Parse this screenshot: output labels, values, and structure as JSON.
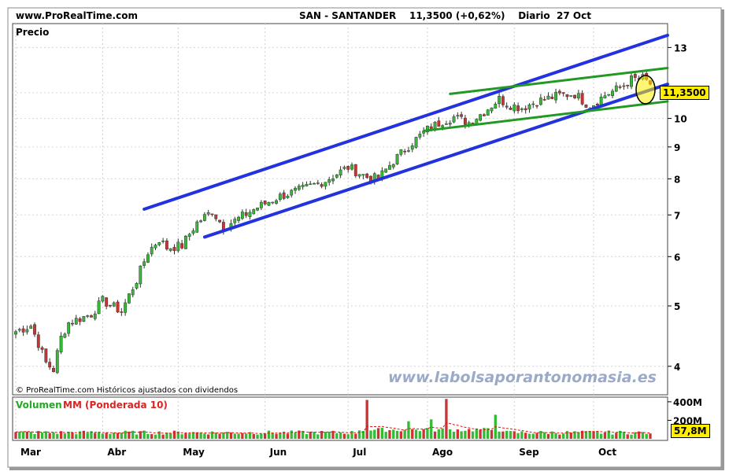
{
  "header": {
    "site": "www.ProRealTime.com",
    "ticker": "SAN - SANTANDER",
    "quote": "11,3500 (+0,62%)",
    "period": "Diario",
    "date": "27 Oct"
  },
  "price_panel": {
    "label": "Precio",
    "last_price_badge": "11,3500",
    "copyright": "© ProRealTime.com  Históricos ajustados con dividendos",
    "watermark": "www.labolsaporantonomasia.es"
  },
  "volume_panel": {
    "label_volume": "Volumen",
    "label_ma": "MM (Ponderada 10)",
    "tick_labels": [
      "400M",
      "200M"
    ],
    "last_volume_badge": "57,8M"
  },
  "colors": {
    "up_candle": "#33bb33",
    "down_candle": "#cc3333",
    "channel": "#2233dd",
    "triangle": "#229922",
    "highlight": "#ffee00",
    "watermark": "#9aaac8",
    "volume_ma": "#e01010"
  },
  "chart_data": {
    "type": "candlestick",
    "y_scale": "log",
    "ylim": [
      3.6,
      14.2
    ],
    "y_ticks": [
      4,
      5,
      6,
      7,
      8,
      9,
      10,
      11,
      13
    ],
    "y_tick_labels": [
      "4",
      "5",
      "6",
      "7",
      "8",
      "9",
      "10",
      "",
      "13"
    ],
    "x_labels": [
      "Mar",
      "Abr",
      "May",
      "Jun",
      "Jul",
      "Ago",
      "Sep",
      "Oct"
    ],
    "x_start_date": "2023-03-01",
    "trading_days": 169,
    "last_close": 11.35,
    "change_pct": 0.62,
    "close_anchors": [
      [
        0,
        4.55
      ],
      [
        4,
        4.65
      ],
      [
        8,
        4.05
      ],
      [
        10,
        3.95
      ],
      [
        12,
        4.45
      ],
      [
        14,
        4.7
      ],
      [
        20,
        4.85
      ],
      [
        23,
        5.1
      ],
      [
        28,
        4.9
      ],
      [
        30,
        5.2
      ],
      [
        32,
        5.5
      ],
      [
        35,
        6.1
      ],
      [
        38,
        6.4
      ],
      [
        40,
        6.2
      ],
      [
        44,
        6.25
      ],
      [
        48,
        6.8
      ],
      [
        52,
        7.1
      ],
      [
        55,
        6.7
      ],
      [
        58,
        6.85
      ],
      [
        64,
        7.2
      ],
      [
        70,
        7.5
      ],
      [
        76,
        7.7
      ],
      [
        82,
        7.95
      ],
      [
        88,
        8.35
      ],
      [
        93,
        8.05
      ],
      [
        96,
        8.0
      ],
      [
        100,
        8.55
      ],
      [
        105,
        9.15
      ],
      [
        109,
        9.6
      ],
      [
        113,
        9.9
      ],
      [
        116,
        10.05
      ],
      [
        120,
        9.85
      ],
      [
        124,
        10.25
      ],
      [
        128,
        10.75
      ],
      [
        130,
        10.55
      ],
      [
        134,
        10.4
      ],
      [
        138,
        10.65
      ],
      [
        144,
        10.9
      ],
      [
        148,
        10.95
      ],
      [
        152,
        10.45
      ],
      [
        156,
        10.9
      ],
      [
        160,
        11.2
      ],
      [
        163,
        11.55
      ],
      [
        166,
        11.6
      ],
      [
        168,
        11.35
      ]
    ],
    "channel_lines": [
      {
        "color": "blue",
        "from": [
          34,
          7.15
        ],
        "to": [
          168,
          13.6
        ]
      },
      {
        "color": "blue",
        "from": [
          50,
          6.45
        ],
        "to": [
          168,
          11.35
        ]
      },
      {
        "color": "green",
        "from": [
          115,
          10.95
        ],
        "to": [
          168,
          12.05
        ]
      },
      {
        "color": "green",
        "from": [
          108,
          9.55
        ],
        "to": [
          168,
          10.65
        ]
      }
    ],
    "volume": {
      "unit": "M",
      "ylim": [
        0,
        450
      ],
      "ticks": [
        400,
        200
      ],
      "spikes": [
        [
          93,
          420
        ],
        [
          114,
          430
        ],
        [
          127,
          260
        ],
        [
          104,
          190
        ],
        [
          110,
          210
        ]
      ],
      "last": 57.8
    }
  }
}
